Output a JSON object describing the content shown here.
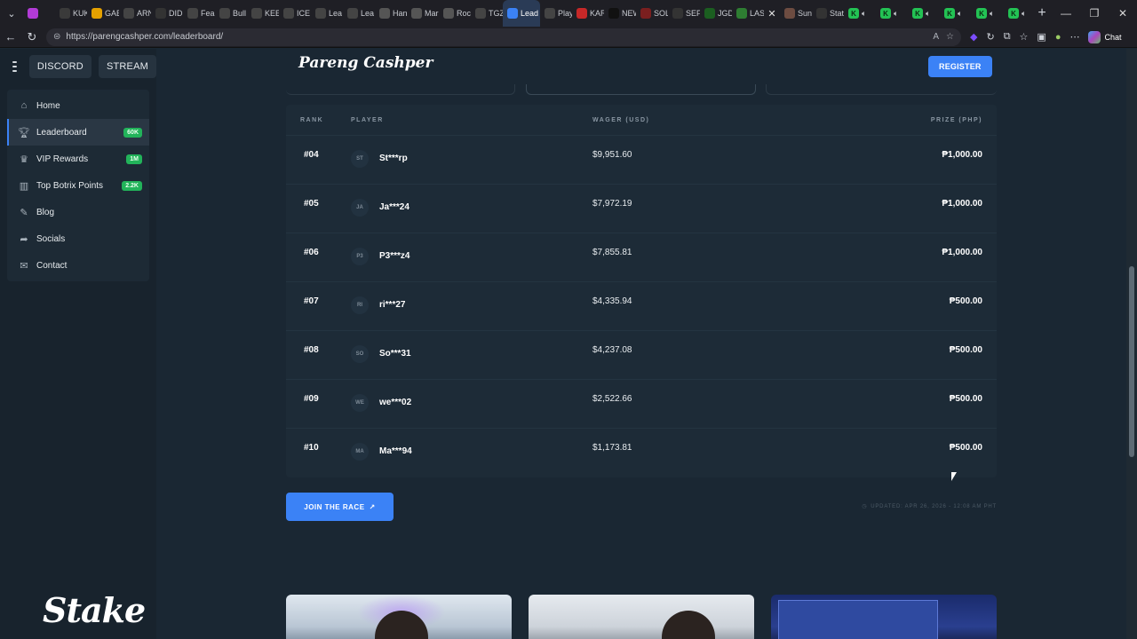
{
  "browser": {
    "tabs": [
      {
        "label": "",
        "color": "#b23bd6"
      },
      {
        "label": "KUK",
        "color": "#3a3a3a"
      },
      {
        "label": "GAE",
        "color": "#e5a100"
      },
      {
        "label": "ARN",
        "color": "#444"
      },
      {
        "label": "DID",
        "color": "#333"
      },
      {
        "label": "Fear",
        "color": "#444"
      },
      {
        "label": "Bull",
        "color": "#444"
      },
      {
        "label": "KEE",
        "color": "#444"
      },
      {
        "label": "ICE",
        "color": "#444"
      },
      {
        "label": "Lea",
        "color": "#444"
      },
      {
        "label": "Lea",
        "color": "#444"
      },
      {
        "label": "Han",
        "color": "#555"
      },
      {
        "label": "Mar",
        "color": "#555"
      },
      {
        "label": "Roc",
        "color": "#555"
      },
      {
        "label": "TGZ",
        "color": "#444"
      },
      {
        "label": "Lead",
        "color": "#3b82f6"
      },
      {
        "label": "Play",
        "color": "#444"
      },
      {
        "label": "KAR",
        "color": "#c62828"
      },
      {
        "label": "NEW",
        "color": "#111"
      },
      {
        "label": "SOL",
        "color": "#7a1f1f"
      },
      {
        "label": "SEP",
        "color": "#333"
      },
      {
        "label": "JGD",
        "color": "#1b5e20"
      },
      {
        "label": "LAS",
        "color": "#2e7d32"
      }
    ],
    "active_tab": "Sun",
    "extra_tabs": [
      "Stat"
    ],
    "url": "https://parengcashper.com/leaderboard/",
    "chat_label": "Chat"
  },
  "sidebar": {
    "discord": "DISCORD",
    "stream": "STREAM",
    "items": [
      {
        "label": "Home",
        "icon": "home-icon",
        "badge": ""
      },
      {
        "label": "Leaderboard",
        "icon": "trophy-icon",
        "badge": "60K"
      },
      {
        "label": "VIP Rewards",
        "icon": "crown-icon",
        "badge": "1M"
      },
      {
        "label": "Top Botrix Points",
        "icon": "chart-icon",
        "badge": "2.2K"
      },
      {
        "label": "Blog",
        "icon": "blog-icon",
        "badge": ""
      },
      {
        "label": "Socials",
        "icon": "share-icon",
        "badge": ""
      },
      {
        "label": "Contact",
        "icon": "mail-icon",
        "badge": ""
      }
    ],
    "sponsor": "Stake"
  },
  "header": {
    "brand": "Pareng Cashper",
    "register": "REGISTER"
  },
  "leaderboard": {
    "columns": {
      "rank": "RANK",
      "player": "PLAYER",
      "wager": "WAGER (USD)",
      "prize": "PRIZE (PHP)"
    },
    "rows": [
      {
        "rank": "#04",
        "initials": "ST",
        "player": "St***rp",
        "wager": "$9,951.60",
        "prize": "₱1,000.00"
      },
      {
        "rank": "#05",
        "initials": "JA",
        "player": "Ja***24",
        "wager": "$7,972.19",
        "prize": "₱1,000.00"
      },
      {
        "rank": "#06",
        "initials": "P3",
        "player": "P3***z4",
        "wager": "$7,855.81",
        "prize": "₱1,000.00"
      },
      {
        "rank": "#07",
        "initials": "RI",
        "player": "ri***27",
        "wager": "$4,335.94",
        "prize": "₱500.00"
      },
      {
        "rank": "#08",
        "initials": "SO",
        "player": "So***31",
        "wager": "$4,237.08",
        "prize": "₱500.00"
      },
      {
        "rank": "#09",
        "initials": "WE",
        "player": "we***02",
        "wager": "$2,522.66",
        "prize": "₱500.00"
      },
      {
        "rank": "#10",
        "initials": "MA",
        "player": "Ma***94",
        "wager": "$1,173.81",
        "prize": "₱500.00"
      }
    ],
    "join_label": "JOIN THE RACE",
    "updated": "UPDATED: APR 26, 2026 - 12:08 AM PHT"
  }
}
